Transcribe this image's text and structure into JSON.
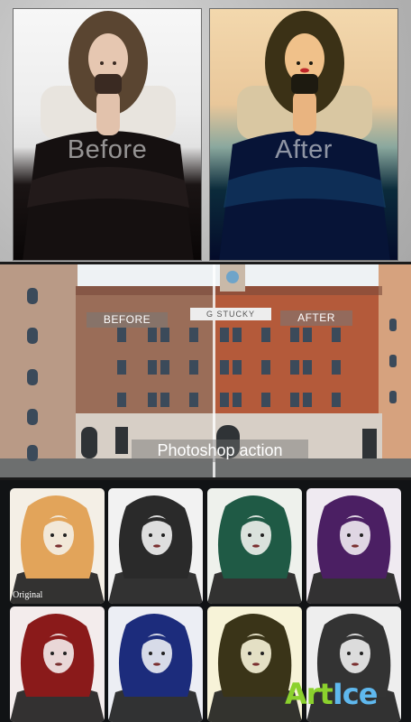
{
  "top_section": {
    "before_label": "Before",
    "after_label": "After"
  },
  "building_section": {
    "before_tag": "BEFORE",
    "after_tag": "AFTER",
    "sign_text": "G STUCKY",
    "caption": "Photoshop action"
  },
  "grid_section": {
    "original_label": "Original",
    "tiles": [
      {
        "tint": "#e2a45a",
        "bg": "#f4efe6"
      },
      {
        "tint": "#2a2a2a",
        "bg": "#f2f2f2"
      },
      {
        "tint": "#1f5a45",
        "bg": "#eef1ec"
      },
      {
        "tint": "#4b1f63",
        "bg": "#efeaf1"
      },
      {
        "tint": "#8a1a1a",
        "bg": "#f3ecec"
      },
      {
        "tint": "#1c2c7c",
        "bg": "#eceef4"
      },
      {
        "tint": "#3a3418",
        "bg": "#f7f3d8"
      },
      {
        "tint": "#333333",
        "bg": "#eeeeee"
      }
    ]
  },
  "watermark": {
    "part1": "Art",
    "part2": "Ice"
  }
}
